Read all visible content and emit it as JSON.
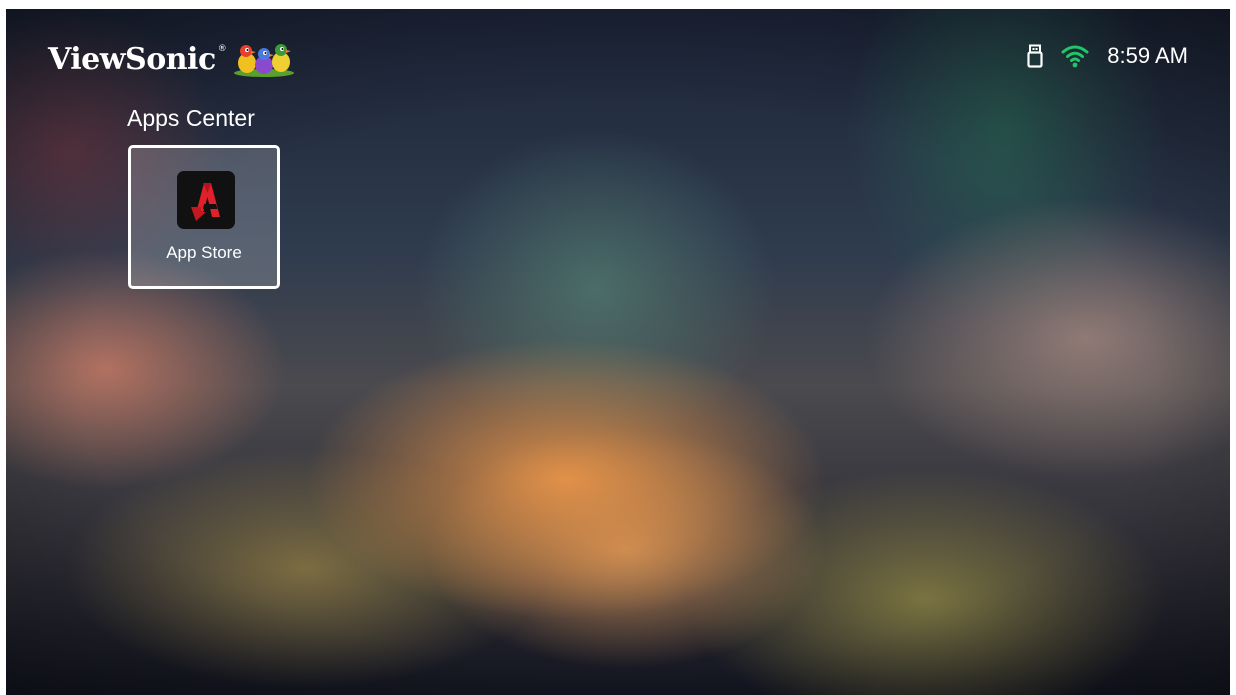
{
  "brand": {
    "name": "ViewSonic",
    "registered": "®",
    "logo_icon": "birds-logo-icon"
  },
  "status_bar": {
    "usb_icon": "usb-drive-icon",
    "wifi_icon": "wifi-icon",
    "wifi_color": "#22c56a",
    "time": "8:59 AM"
  },
  "section": {
    "title": "Apps Center"
  },
  "apps": [
    {
      "label": "App Store",
      "icon": "app-store-icon",
      "accent": "#e0202a",
      "focused": true
    }
  ]
}
